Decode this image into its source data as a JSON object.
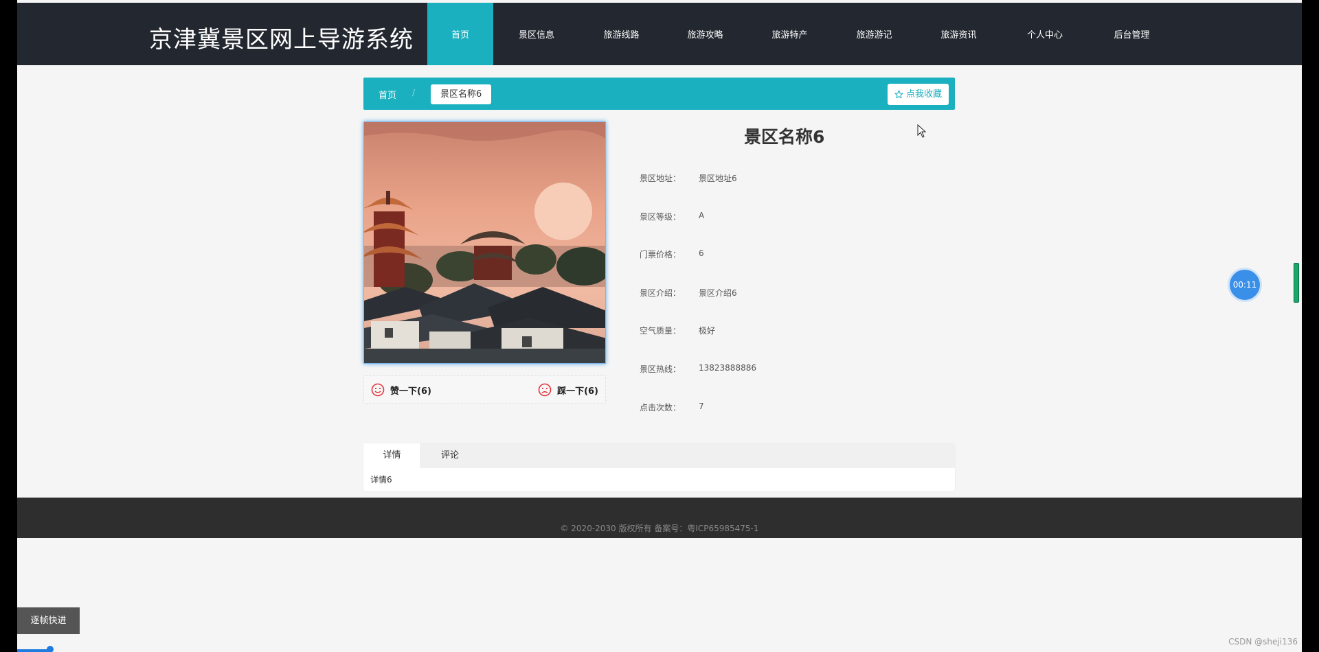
{
  "header": {
    "site_title": "京津冀景区网上导游系统",
    "nav": [
      {
        "label": "首页",
        "active": true
      },
      {
        "label": "景区信息"
      },
      {
        "label": "旅游线路"
      },
      {
        "label": "旅游攻略"
      },
      {
        "label": "旅游特产"
      },
      {
        "label": "旅游游记"
      },
      {
        "label": "旅游资讯"
      },
      {
        "label": "个人中心"
      },
      {
        "label": "后台管理"
      }
    ]
  },
  "breadcrumb": {
    "home": "首页",
    "separator": "/",
    "current": "景区名称6",
    "favorite_label": "点我收藏"
  },
  "spot": {
    "name": "景区名称6",
    "fields": [
      {
        "label": "景区地址：",
        "value": "景区地址6"
      },
      {
        "label": "景区等级：",
        "value": "A"
      },
      {
        "label": "门票价格：",
        "value": "6"
      },
      {
        "label": "景区介绍：",
        "value": "景区介绍6"
      },
      {
        "label": "空气质量：",
        "value": "极好"
      },
      {
        "label": "景区热线：",
        "value": "13823888886"
      },
      {
        "label": "点击次数：",
        "value": "7"
      }
    ],
    "like_label": "赞一下(6)",
    "dislike_label": "踩一下(6)"
  },
  "tabs": {
    "items": [
      {
        "label": "详情",
        "active": true
      },
      {
        "label": "评论"
      }
    ],
    "content": "详情6"
  },
  "footer": {
    "copyright": "© 2020-2030 版权所有 备案号：粤ICP65985475-1"
  },
  "overlay": {
    "timer": "00:11",
    "frame_button": "逐帧快进",
    "watermark": "CSDN @sheji136"
  },
  "colors": {
    "accent": "#1ab0bf",
    "header_bg": "#232830",
    "footer_bg": "#2e2e2e"
  }
}
